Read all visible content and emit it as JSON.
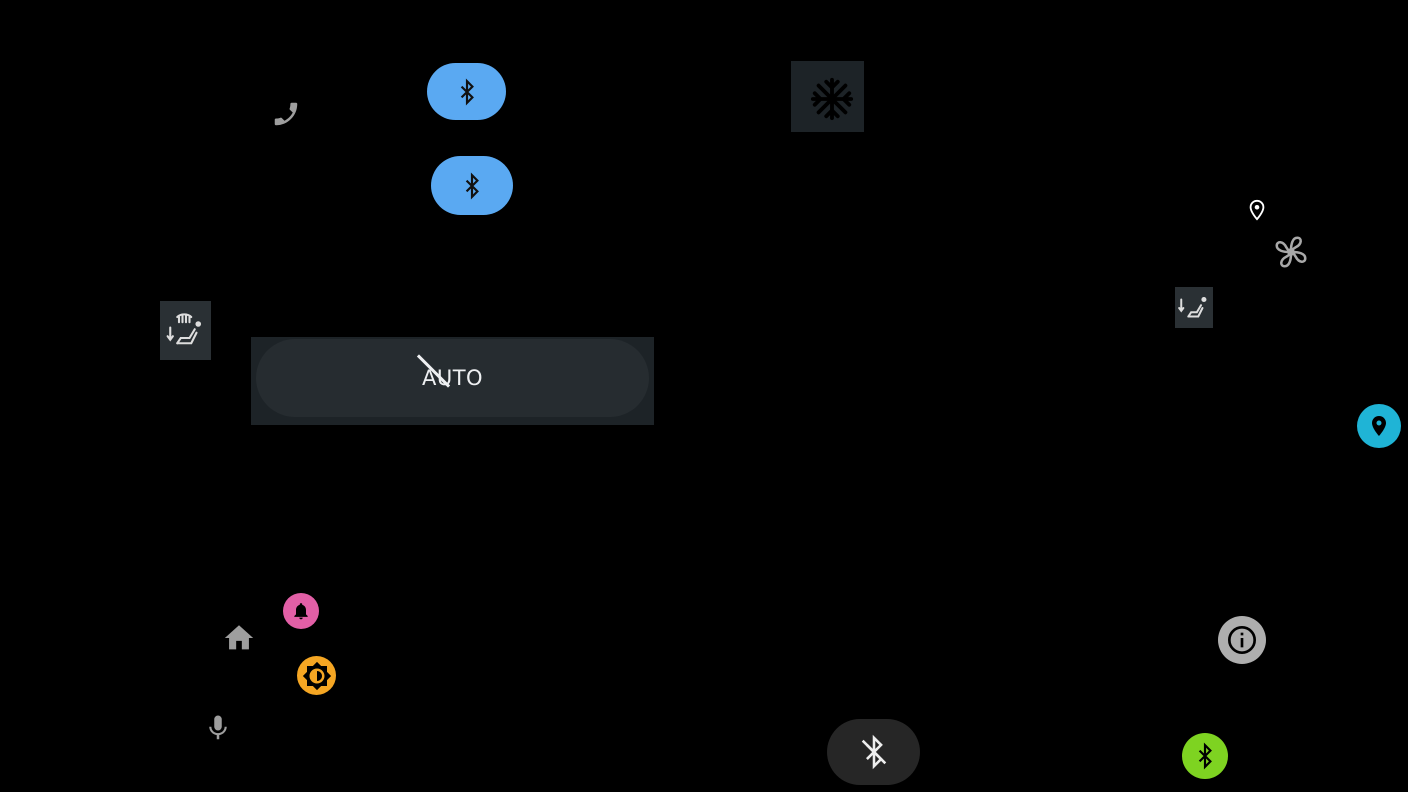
{
  "colors": {
    "background": "#000000",
    "bluetooth_pill": "#5aa9f2",
    "climate_tile": "#1d2327",
    "auto_pill": "#262c30",
    "notification": "#e25fa6",
    "brightness": "#f5a623",
    "location_accent": "#1fb4d6",
    "bluetooth_active": "#7ed321",
    "info_button": "#aeaeae",
    "bluetooth_off_pill": "#262626",
    "muted_icon": "#9e9e9e"
  },
  "climate": {
    "auto_label": "AUTO",
    "auto_state": "off"
  },
  "icons": {
    "phone": "phone-icon",
    "bluetooth": "bluetooth-icon",
    "bluetooth_disabled": "bluetooth-disabled-icon",
    "ac": "snowflake-icon",
    "location": "location-pin-icon",
    "fan": "fan-icon",
    "seat_heat": "heated-seat-icon",
    "seat_airflow": "seat-airflow-icon",
    "home": "home-icon",
    "notification": "bell-icon",
    "brightness": "brightness-icon",
    "microphone": "microphone-icon",
    "info": "info-icon"
  }
}
